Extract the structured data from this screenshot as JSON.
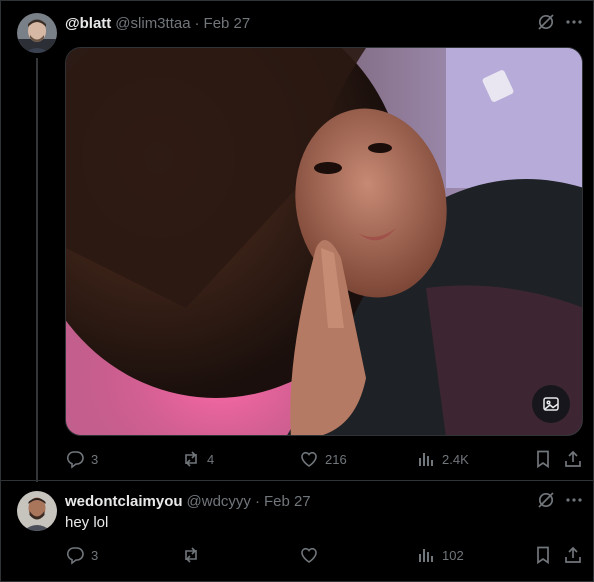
{
  "post": {
    "display_name": "@blatt",
    "handle": "@slim3ttaa",
    "separator": "·",
    "date": "Feb 27",
    "media_alt_icon": "image-alt-icon",
    "stats": {
      "replies": "3",
      "reposts": "4",
      "likes": "216",
      "views": "2.4K"
    }
  },
  "reply": {
    "display_name": "wedontclaimyou",
    "handle": "@wdcyyy",
    "separator": "·",
    "date": "Feb 27",
    "text": "hey lol",
    "stats": {
      "replies": "3",
      "reposts": "",
      "likes": "",
      "views": "102"
    }
  },
  "icons": {
    "grok": "grok-icon",
    "more": "more-icon",
    "reply": "reply-icon",
    "repost": "repost-icon",
    "like": "heart-icon",
    "views": "views-icon",
    "bookmark": "bookmark-icon",
    "share": "share-icon"
  },
  "colors": {
    "background": "#000000",
    "text_primary": "#e7e9ea",
    "text_secondary": "#71767b",
    "border": "#2f3336"
  }
}
